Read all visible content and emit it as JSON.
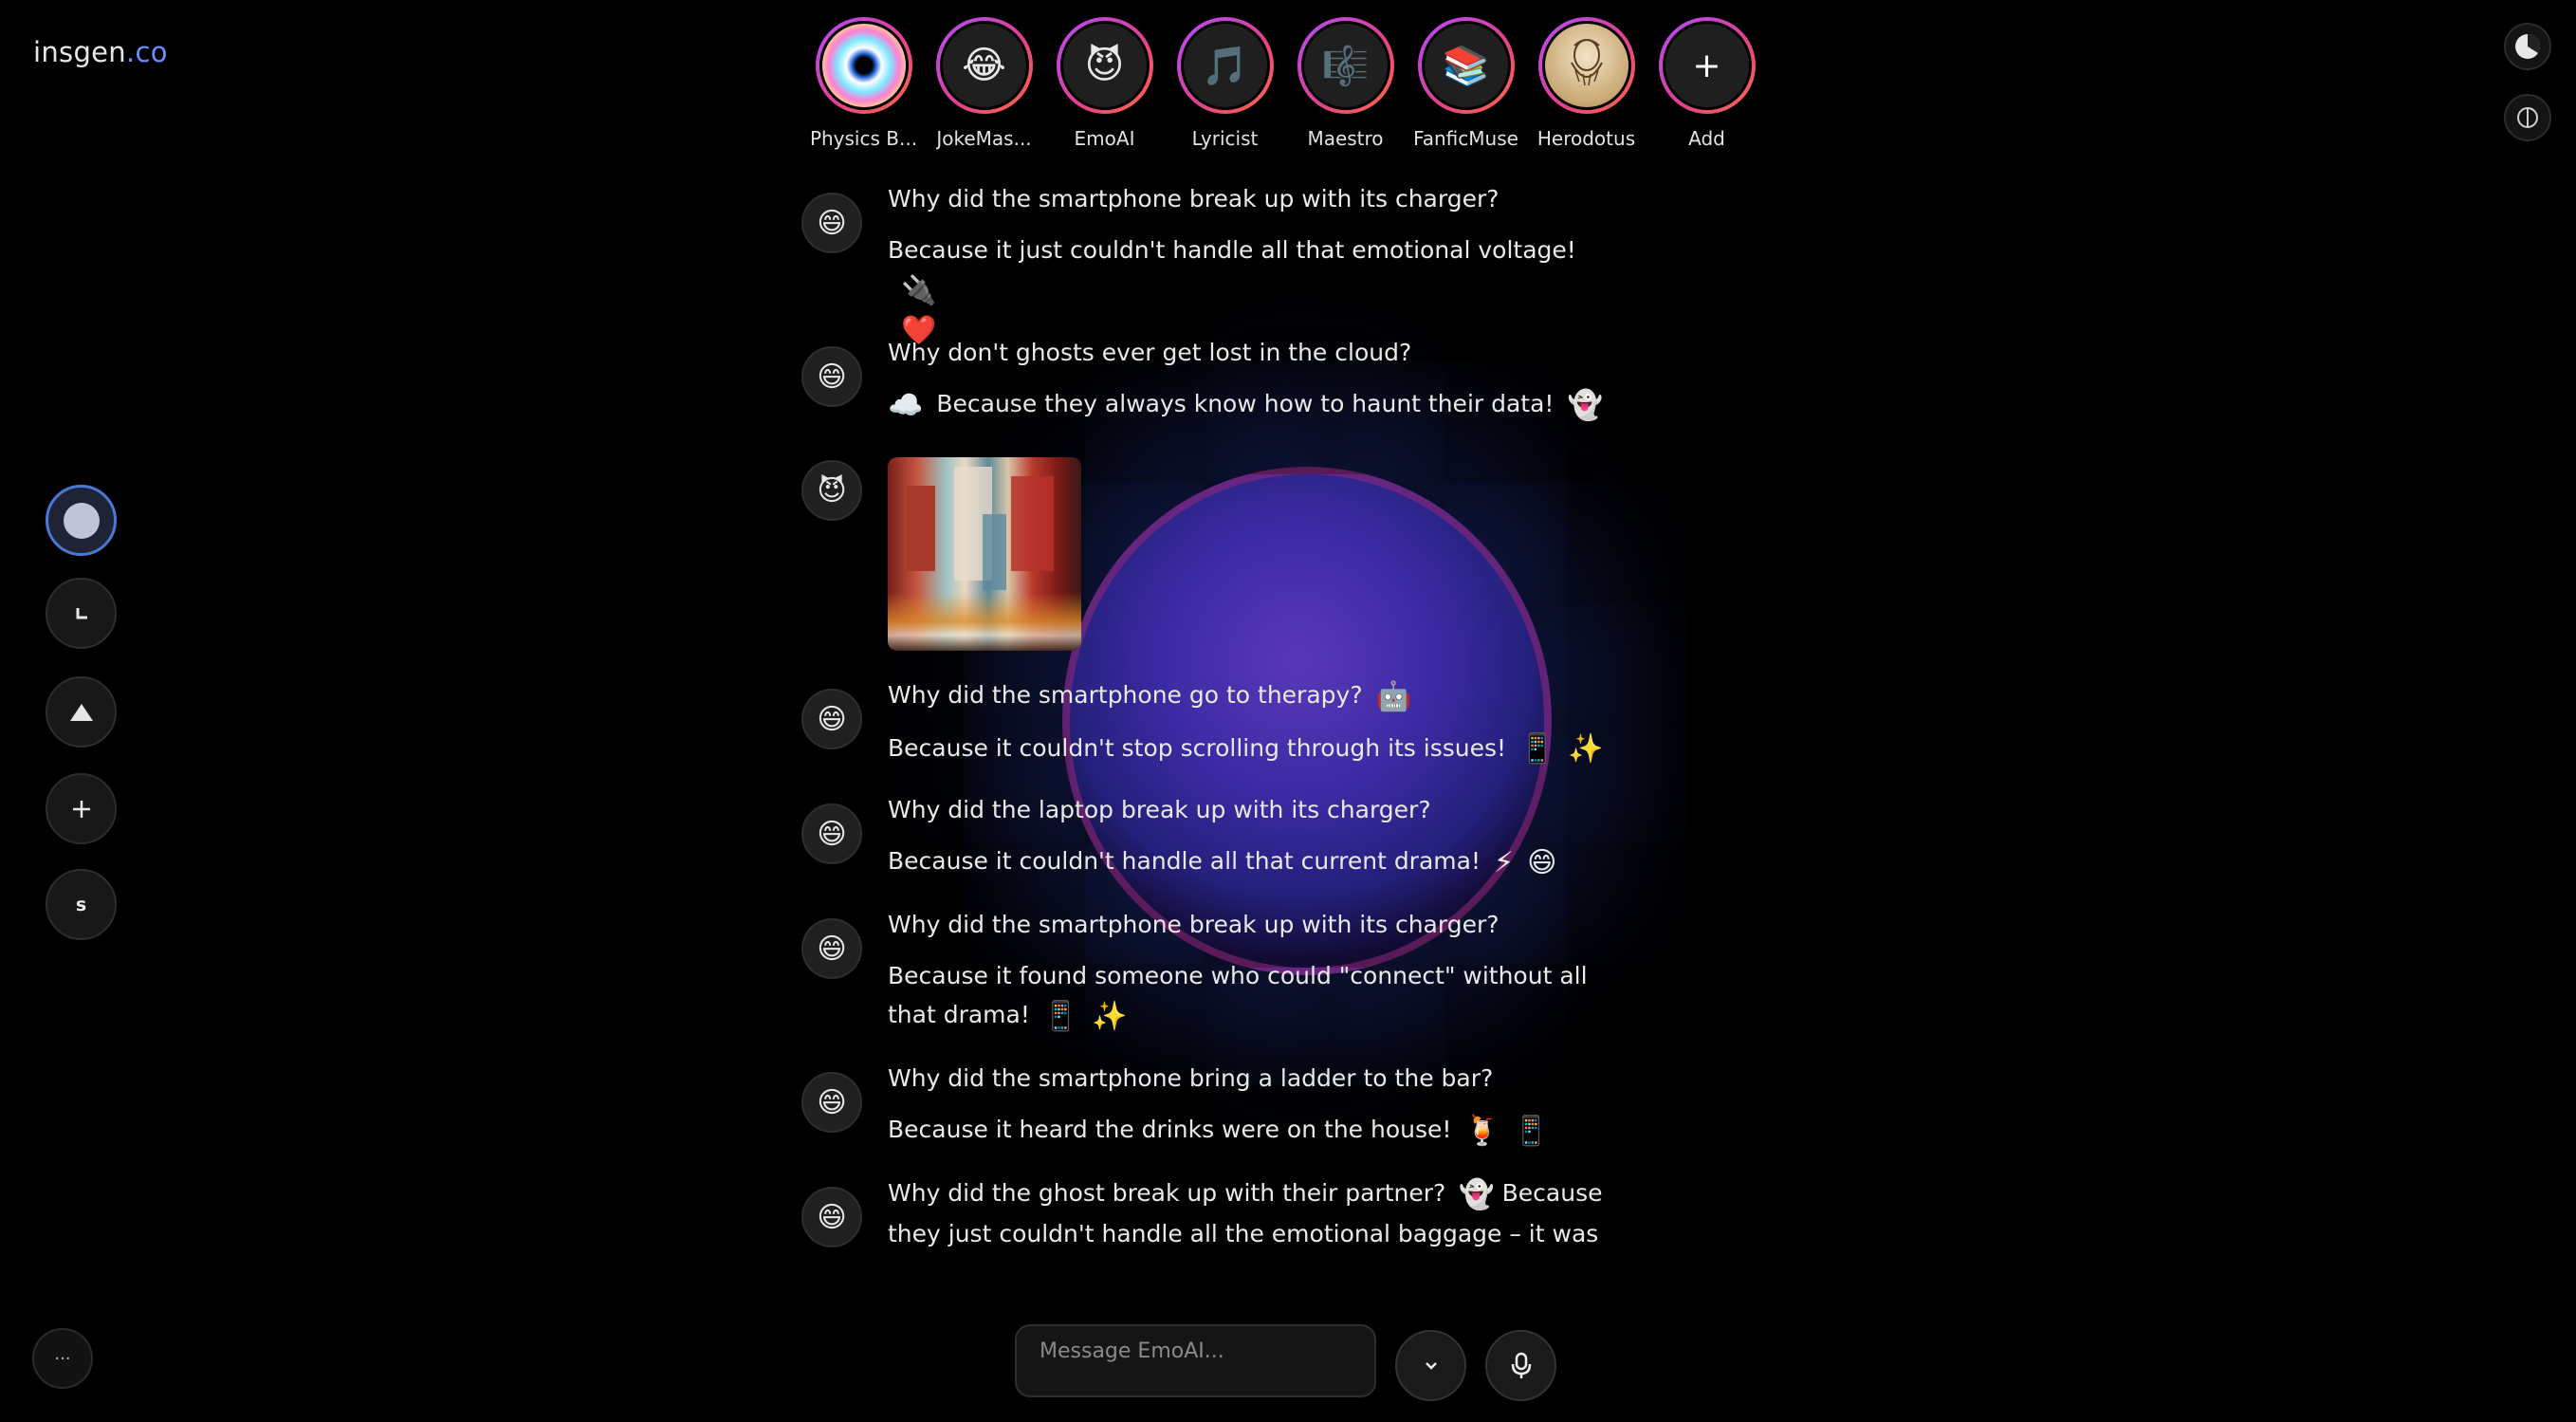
{
  "logo": {
    "main": "insgen",
    "accent": ".co"
  },
  "stories": [
    {
      "name": "Physics B...",
      "icon": "rainbow-eye"
    },
    {
      "name": "JokeMas...",
      "icon": "😂"
    },
    {
      "name": "EmoAI",
      "icon": "😈"
    },
    {
      "name": "Lyricist",
      "icon": "🎵"
    },
    {
      "name": "Maestro",
      "icon": "🎼"
    },
    {
      "name": "FanficMuse",
      "icon": "📚"
    },
    {
      "name": "Herodotus",
      "icon": "portrait"
    },
    {
      "name": "Add",
      "icon": "+"
    }
  ],
  "sidebar": {
    "s_label": "s",
    "more_label": "···"
  },
  "messages": [
    {
      "avatar": "😄",
      "q": "Why did the smartphone break up with its charger?",
      "a": "Because it just couldn't handle all that emotional voltage!",
      "emojis": [
        "🔌",
        "❤️"
      ]
    },
    {
      "avatar": "😄",
      "q": "Why don't ghosts ever get lost in the cloud?",
      "a": "Because they always know how to haunt their data!",
      "pre": "☁️",
      "emojis": [
        "👻"
      ]
    },
    {
      "avatar": "😈",
      "image": "abstract-painting"
    },
    {
      "avatar": "😄",
      "q": "Why did the smartphone go to therapy?",
      "q_emoji": "🤖",
      "a": "Because it couldn't stop scrolling through its issues!",
      "emojis": [
        "📱",
        "✨"
      ]
    },
    {
      "avatar": "😄",
      "q": "Why did the laptop break up with its charger?",
      "a": "Because it couldn't handle all that current drama!",
      "emojis": [
        "⚡",
        "😄"
      ]
    },
    {
      "avatar": "😄",
      "q": "Why did the smartphone break up with its charger?",
      "a": "Because it found someone who could \"connect\" without all that drama!",
      "emojis": [
        "📱",
        "✨"
      ]
    },
    {
      "avatar": "😄",
      "q": "Why did the smartphone bring a ladder to the bar?",
      "a": "Because it heard the drinks were on the house!",
      "emojis": [
        "🍹",
        "📱"
      ]
    },
    {
      "avatar": "😄",
      "q": "Why did the ghost break up with their partner?",
      "q_emoji": "👻",
      "a": "Because they just couldn't handle all the emotional baggage – it was too"
    }
  ],
  "input": {
    "placeholder": "Message EmoAI..."
  }
}
